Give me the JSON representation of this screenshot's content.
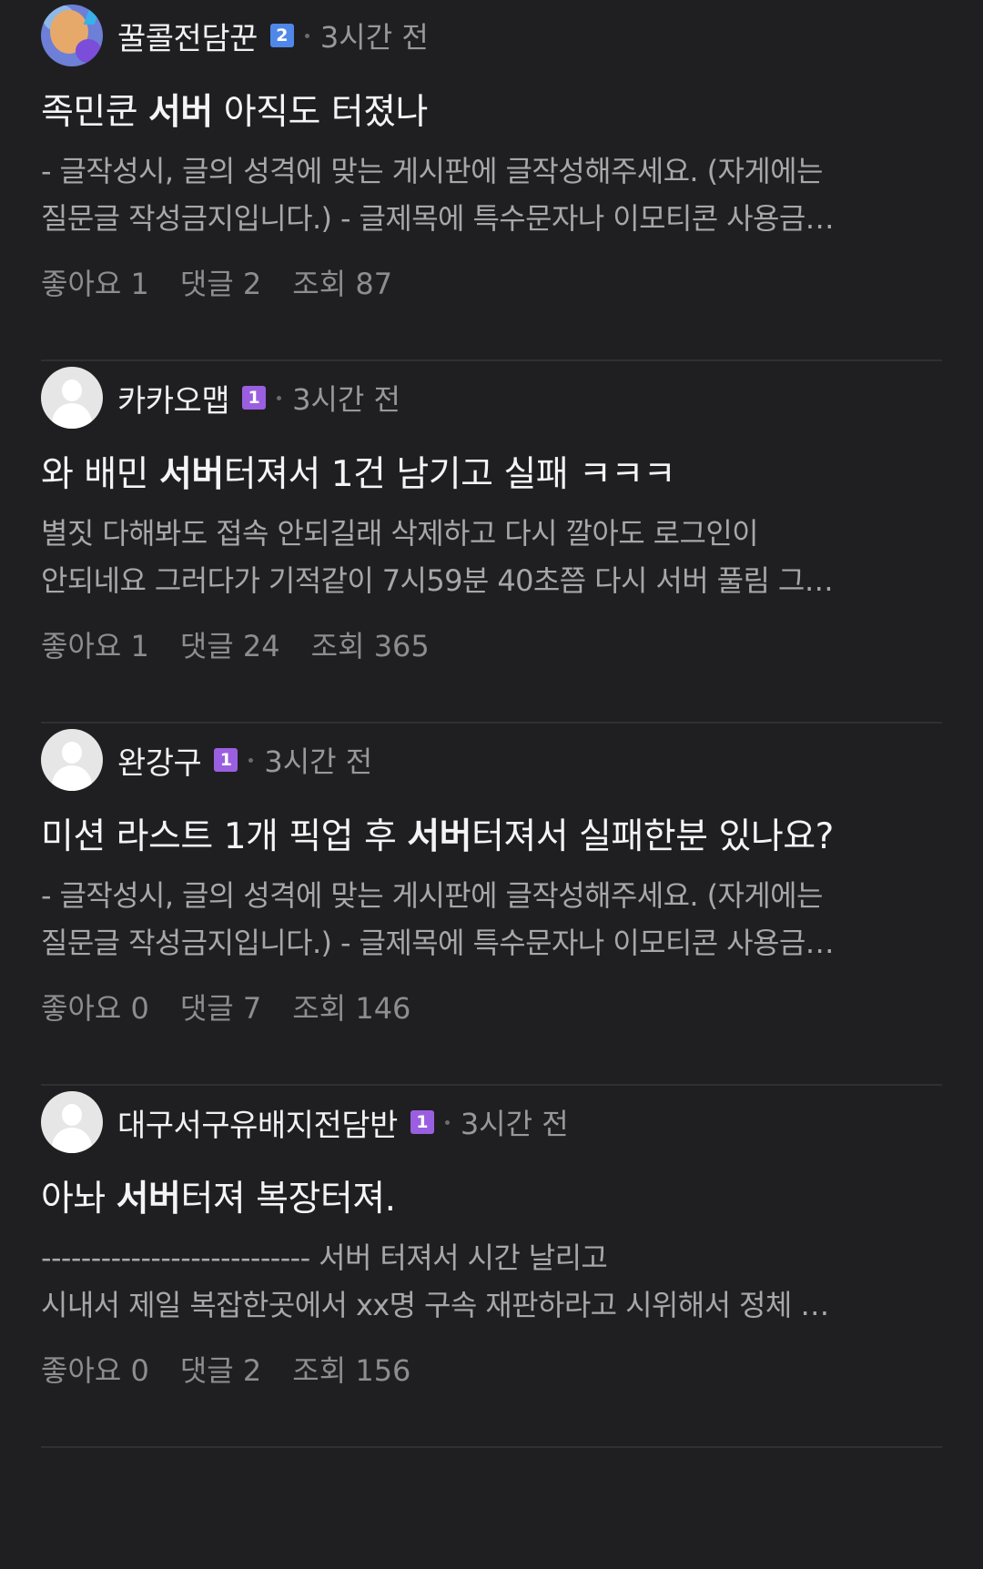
{
  "posts": [
    {
      "author": "꿀콜전담꾼",
      "level": "2",
      "level_color": "#4f88e8",
      "time": "3시간 전",
      "title_pre": "족민쿤 ",
      "title_bold": "서버",
      "title_post": " 아직도 터졌나",
      "excerpt_line1": "- 글작성시, 글의 성격에 맞는 게시판에 글작성해주세요. (자게에는",
      "excerpt_line2": "질문글 작성금지입니다.) - 글제목에 특수문자나 이모티콘 사용금…",
      "likes": "좋아요 1",
      "comments": "댓글 2",
      "views": "조회 87",
      "avatar": "custom-character-avatar"
    },
    {
      "author": "카카오맵",
      "level": "1",
      "level_color": "#9a5fe0",
      "time": "3시간 전",
      "title_pre": "와 배민 ",
      "title_bold": "서버",
      "title_post": "터져서 1건 남기고 실패 ㅋㅋㅋ",
      "excerpt_line1": "별짓 다해봐도 접속 안되길래 삭제하고 다시 깔아도 로그인이",
      "excerpt_line2": "안되네요 그러다가 기적같이 7시59분 40초쯤 다시 서버 풀림 그…",
      "likes": "좋아요 1",
      "comments": "댓글 24",
      "views": "조회 365",
      "avatar": "default-user-avatar"
    },
    {
      "author": "완강구",
      "level": "1",
      "level_color": "#9a5fe0",
      "time": "3시간 전",
      "title_pre": "미션 라스트 1개 픽업 후 ",
      "title_bold": "서버",
      "title_post": "터져서 실패한분 있나요?",
      "excerpt_line1": "- 글작성시, 글의 성격에 맞는 게시판에 글작성해주세요. (자게에는",
      "excerpt_line2": "질문글 작성금지입니다.) - 글제목에 특수문자나 이모티콘 사용금…",
      "likes": "좋아요 0",
      "comments": "댓글 7",
      "views": "조회 146",
      "avatar": "default-user-avatar"
    },
    {
      "author": "대구서구유배지전담반",
      "level": "1",
      "level_color": "#9a5fe0",
      "time": "3시간 전",
      "title_pre": "아놔 ",
      "title_bold": "서버",
      "title_post": "터져 복장터져.",
      "excerpt_line1": "--------------------------- 서버 터져서 시간 날리고",
      "excerpt_line2": "시내서 제일 복잡한곳에서 xx명 구속 재판하라고 시위해서 정체 …",
      "likes": "좋아요 0",
      "comments": "댓글 2",
      "views": "조회 156",
      "avatar": "default-user-avatar"
    }
  ]
}
